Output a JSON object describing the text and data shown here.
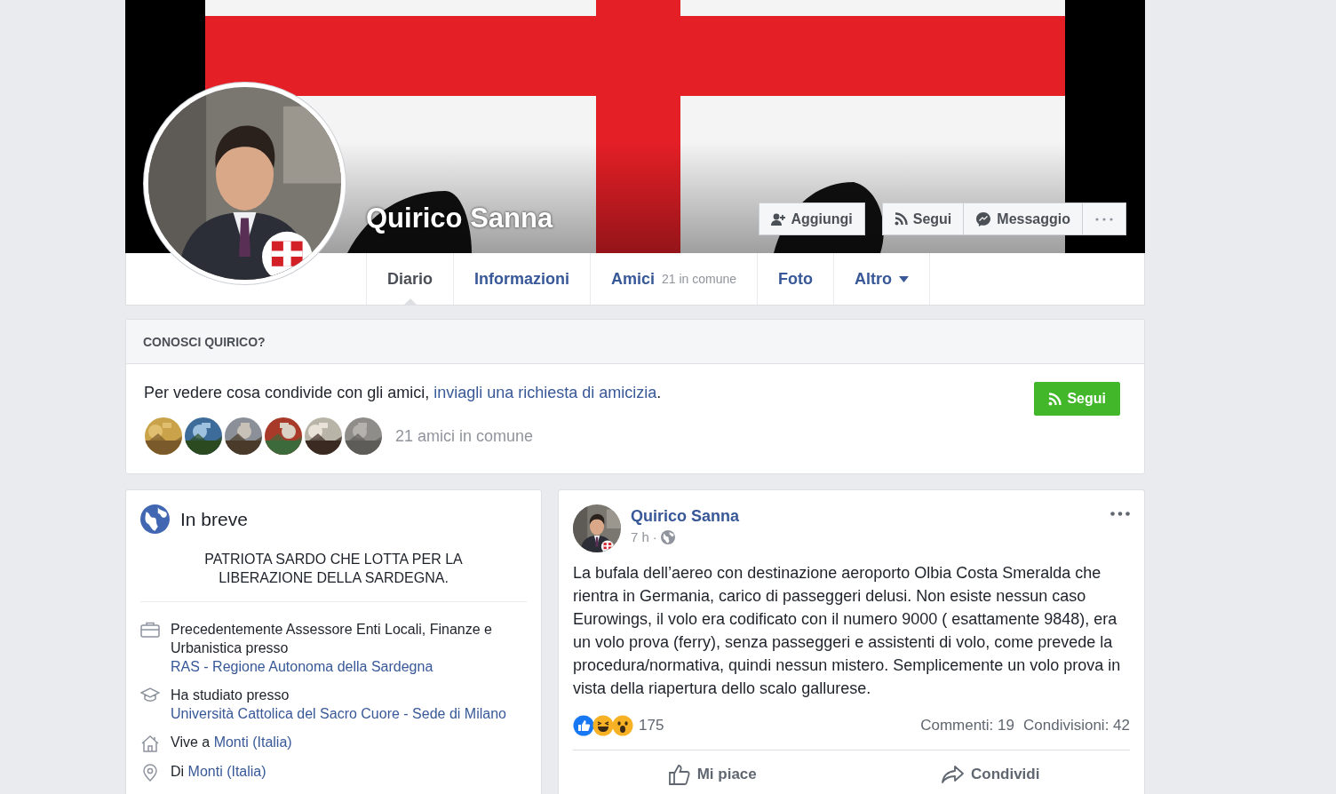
{
  "profile": {
    "name": "Quirico Sanna",
    "buttons": [
      {
        "kind": "add",
        "label": "Aggiungi"
      },
      {
        "kind": "follow",
        "label": "Segui"
      },
      {
        "kind": "message",
        "label": "Messaggio"
      },
      {
        "kind": "more"
      }
    ]
  },
  "tabs": [
    {
      "label": "Diario",
      "selected": true
    },
    {
      "label": "Informazioni",
      "selected": false
    },
    {
      "label": "Amici",
      "count": "21 in comune",
      "selected": false
    },
    {
      "label": "Foto",
      "selected": false
    },
    {
      "label": "Altro",
      "kind": "menu",
      "selected": false
    }
  ],
  "know": {
    "title": "CONOSCI QUIRICO?",
    "text": "Per vedere cosa condivide con gli amici, ",
    "link": "inviagli una richiesta di amicizia",
    "after": ".",
    "button": "Segui",
    "friends_label": "21 amici in comune"
  },
  "intro": {
    "title": "In breve",
    "bio": "PATRIOTA SARDO CHE LOTTA PER LA LIBERAZIONE DELLA SARDEGNA.",
    "items": [
      {
        "kind": "work",
        "text": "Precedentemente Assessore Enti Locali, Finanze e Urbanistica presso ",
        "link": "RAS - Regione Autonoma della Sardegna"
      },
      {
        "kind": "study",
        "text": "Ha studiato presso ",
        "link": "Università Cattolica del Sacro Cuore - Sede di Milano"
      },
      {
        "kind": "home",
        "text": "Vive a ",
        "link": "Monti (Italia)"
      },
      {
        "kind": "place",
        "text": "Di ",
        "link": "Monti (Italia)"
      }
    ]
  },
  "post": {
    "author": "Quirico Sanna",
    "time": "7 h",
    "separator": "·",
    "text": "La bufala dell’aereo con destinazione aeroporto Olbia Costa Smeralda che rientra in Germania, carico di passeggeri delusi. Non esiste nessun caso Eurowings, il volo era codificato con il numero 9000 ( esattamente 9848), era un volo prova (ferry), senza passeggeri e assistenti di volo, come prevede la procedura/normativa, quindi nessun mistero. Semplicemente un volo prova in vista della riapertura dello scalo gallurese.",
    "reactions": [
      {
        "kind": "like"
      },
      {
        "kind": "haha"
      },
      {
        "kind": "wow"
      }
    ],
    "reaction_count": "175",
    "comments": "Commenti: 19",
    "shares": "Condivisioni: 42",
    "actions": [
      {
        "kind": "like",
        "label": "Mi piace"
      },
      {
        "kind": "share",
        "label": "Condividi"
      }
    ]
  }
}
